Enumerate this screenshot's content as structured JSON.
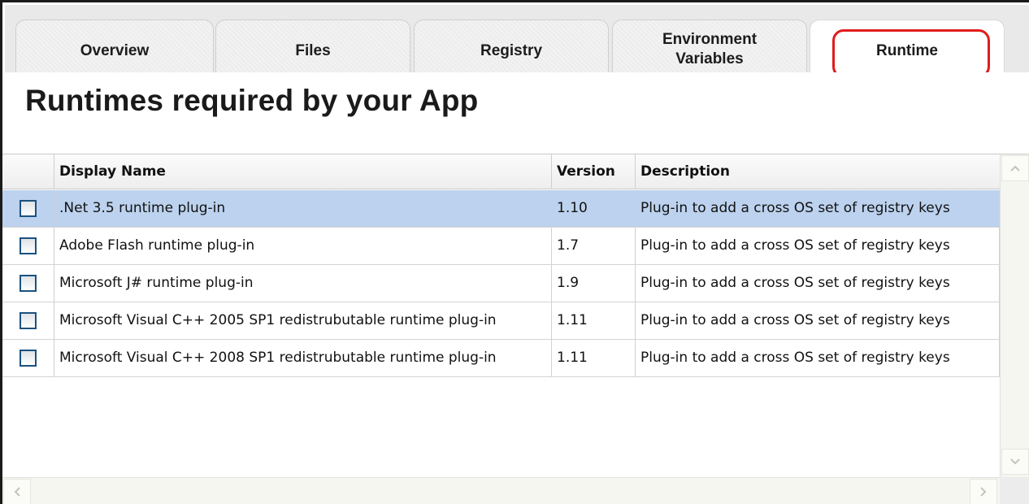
{
  "tabs": [
    {
      "label": "Overview",
      "active": false
    },
    {
      "label": "Files",
      "active": false
    },
    {
      "label": "Registry",
      "active": false
    },
    {
      "label": "Environment Variables",
      "active": false
    },
    {
      "label": "Runtime",
      "active": true
    }
  ],
  "page_title": "Runtimes required by your App",
  "grid": {
    "headers": {
      "display_name": "Display Name",
      "version": "Version",
      "description": "Description"
    },
    "rows": [
      {
        "checked": false,
        "selected": true,
        "display_name": ".Net 3.5 runtime plug-in",
        "version": "1.10",
        "description": "Plug-in to add a cross OS set of registry keys"
      },
      {
        "checked": false,
        "selected": false,
        "display_name": "Adobe Flash runtime plug-in",
        "version": "1.7",
        "description": "Plug-in to add a cross OS set of registry keys"
      },
      {
        "checked": false,
        "selected": false,
        "display_name": "Microsoft J# runtime plug-in",
        "version": "1.9",
        "description": "Plug-in to add a cross OS set of registry keys"
      },
      {
        "checked": false,
        "selected": false,
        "display_name": "Microsoft Visual C++ 2005 SP1 redistrubutable runtime plug-in",
        "version": "1.11",
        "description": "Plug-in to add a cross OS set of registry keys"
      },
      {
        "checked": false,
        "selected": false,
        "display_name": "Microsoft Visual C++ 2008 SP1 redistrubutable runtime plug-in",
        "version": "1.11",
        "description": "Plug-in to add a cross OS set of registry keys"
      }
    ]
  },
  "colors": {
    "selected_row": "#bcd2ee",
    "highlight_ring": "#e11b1b",
    "checkbox_border": "#1c5180"
  },
  "icons": {
    "scroll_up": "chevron-up-icon",
    "scroll_down": "chevron-down-icon",
    "scroll_left": "chevron-left-icon",
    "scroll_right": "chevron-right-icon"
  }
}
